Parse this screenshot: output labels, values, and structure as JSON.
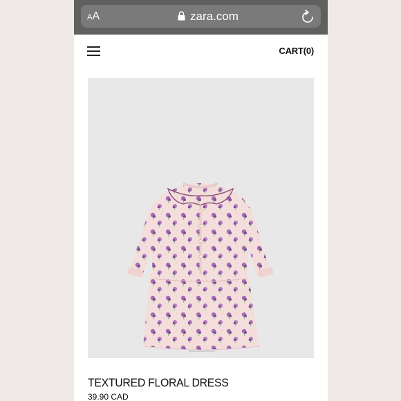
{
  "browser": {
    "text_size_label_small": "A",
    "text_size_label_large": "A",
    "url": "zara.com",
    "lock_icon": "lock-icon",
    "reload_icon": "reload-icon"
  },
  "header": {
    "menu_icon": "hamburger-menu-icon",
    "cart_label": "CART(0)"
  },
  "product": {
    "image_description_icon": "dress-image",
    "title": "TEXTURED FLORAL DRESS",
    "price": "39.90 CAD"
  },
  "colors": {
    "browser_bar": "#606060",
    "url_pill": "#7a7a7a",
    "image_bg": "#e9e8e9",
    "dress_base": "#f3dcd9",
    "dress_flower": "#a46bb0",
    "dress_trim": "#8e4a7a"
  }
}
